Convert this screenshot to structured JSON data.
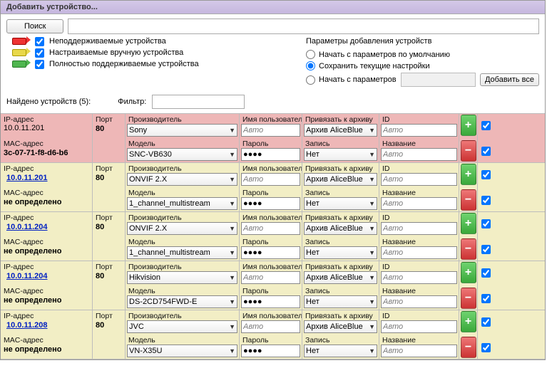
{
  "window": {
    "title": "Добавить устройство..."
  },
  "toolbar": {
    "search": "Поиск",
    "add_all": "Добавить все"
  },
  "legend": {
    "unsupported": "Неподдерживаемые устройства",
    "manual": "Настраиваемые вручную устройства",
    "full": "Полностью поддерживаемые устройства"
  },
  "params": {
    "header": "Параметры добавления устройств",
    "default": "Начать с параметров по умолчанию",
    "keep": "Сохранить текущие настройки",
    "start_with": "Начать с параметров"
  },
  "found": {
    "label": "Найдено устройств (5):",
    "filter_label": "Фильтр:"
  },
  "headers": {
    "ip": "IP-адрес",
    "port": "Порт",
    "vendor": "Производитель",
    "mac": "MAC-адрес",
    "model": "Модель",
    "user": "Имя пользователя",
    "password": "Пароль",
    "archive": "Привязать к архиву",
    "record": "Запись",
    "id": "ID",
    "name": "Название"
  },
  "common": {
    "auto": "Авто",
    "pw_mask": "●●●●",
    "archive_val": "Архив AliceBlue",
    "record_no": "Нет",
    "undef": "не определено"
  },
  "devices": [
    {
      "tone": "red",
      "ip": "10.0.11.201",
      "ip_link": false,
      "port": "80",
      "vendor": "Sony",
      "model": "SNC-VB630",
      "mac": "3c-07-71-f8-d6-b6"
    },
    {
      "tone": "yellow",
      "ip": "10.0.11.201",
      "ip_link": true,
      "port": "80",
      "vendor": "ONVIF 2.X",
      "model": "1_channel_multistream",
      "mac": "undef"
    },
    {
      "tone": "yellow",
      "ip": "10.0.11.204",
      "ip_link": true,
      "port": "80",
      "vendor": "ONVIF 2.X",
      "model": "1_channel_multistream",
      "mac": "undef"
    },
    {
      "tone": "yellow",
      "ip": "10.0.11.204",
      "ip_link": true,
      "port": "80",
      "vendor": "Hikvision",
      "model": "DS-2CD754FWD-E",
      "mac": "undef"
    },
    {
      "tone": "yellow",
      "ip": "10.0.11.208",
      "ip_link": true,
      "port": "80",
      "vendor": "JVC",
      "model": "VN-X35U",
      "mac": "undef"
    }
  ]
}
